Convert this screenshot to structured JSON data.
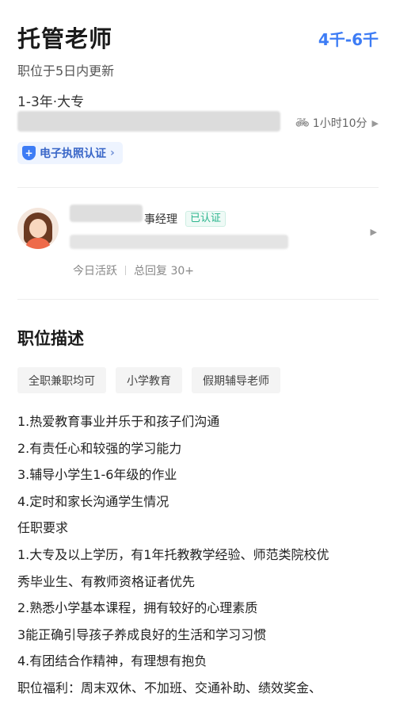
{
  "job": {
    "title": "托管老师",
    "salary": "4千-6千",
    "updated": "职位于5日内更新",
    "requirements": "1-3年·大专",
    "commute": "1小时10分",
    "license_badge": "电子执照认证"
  },
  "recruiter": {
    "role": "事经理",
    "verified": "已认证",
    "active": "今日活跃",
    "replies": "总回复 30+"
  },
  "description": {
    "section_title": "职位描述",
    "tags": [
      "全职兼职均可",
      "小学教育",
      "假期辅导老师"
    ],
    "lines": [
      "1.热爱教育事业并乐于和孩子们沟通",
      "2.有责任心和较强的学习能力",
      "3.辅导小学生1-6年级的作业",
      "4.定时和家长沟通学生情况",
      "任职要求",
      "1.大专及以上学历，有1年托教教学经验、师范类院校优",
      "秀毕业生、有教师资格证者优先",
      "2.熟悉小学基本课程，拥有较好的心理素质",
      "3能正确引导孩子养成良好的生活和学习习惯",
      "4.有团结合作精神，有理想有抱负",
      "职位福利：周末双休、不加班、交通补助、绩效奖金、"
    ]
  },
  "icons": {
    "commute": "bicycle-icon",
    "license": "shield-check-icon",
    "chevron": "chevron-right-icon"
  },
  "colors": {
    "accent": "#3d7cf5",
    "verified": "#2bb58d",
    "badge_bg": "#eef4ff"
  }
}
